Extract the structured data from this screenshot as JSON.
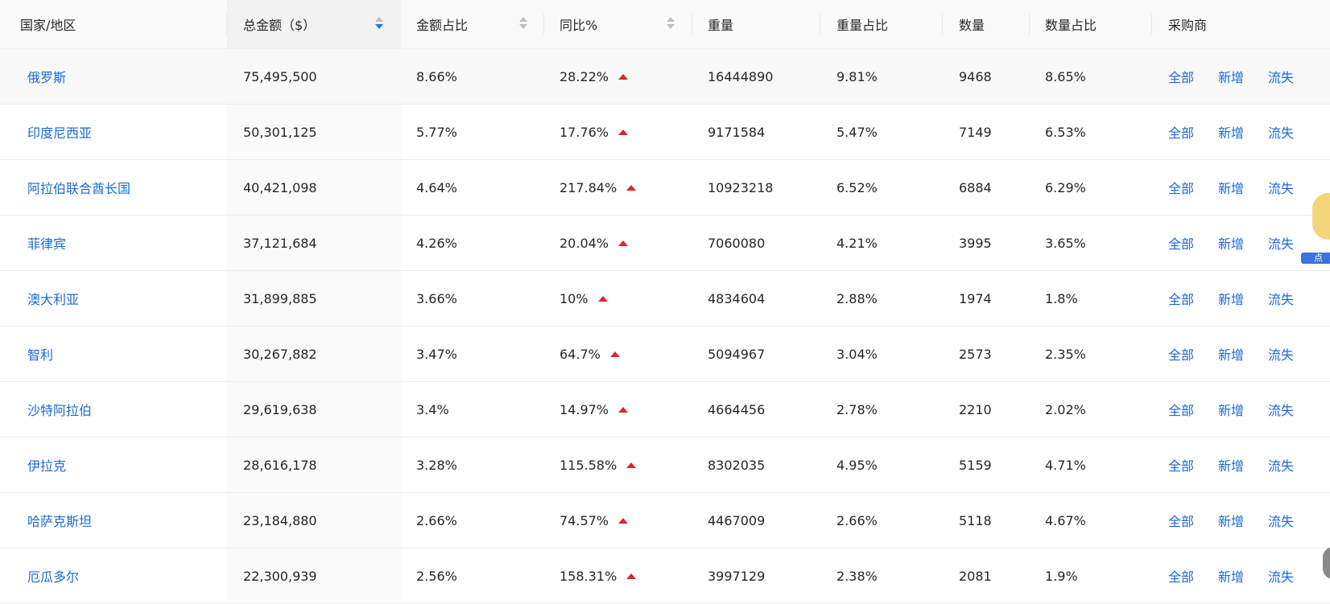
{
  "columns": {
    "country": "国家/地区",
    "total": "总金额（$）",
    "amount_share": "金额占比",
    "yoy": "同比%",
    "weight": "重量",
    "weight_share": "重量占比",
    "count": "数量",
    "count_share": "数量占比",
    "buyers": "采购商"
  },
  "sort": {
    "column": "total",
    "direction": "desc",
    "sort_indicator_color": "#1677ff"
  },
  "colors": {
    "link": "#1a6ad6",
    "up_arrow": "#e0242f"
  },
  "actions": {
    "all": "全部",
    "new": "新增",
    "lost": "流失"
  },
  "mascot_label": "点",
  "rows": [
    {
      "country": "俄罗斯",
      "total": "75,495,500",
      "amount_share": "8.66%",
      "yoy": "28.22%",
      "weight": "16444890",
      "weight_share": "9.81%",
      "count": "9468",
      "count_share": "8.65%"
    },
    {
      "country": "印度尼西亚",
      "total": "50,301,125",
      "amount_share": "5.77%",
      "yoy": "17.76%",
      "weight": "9171584",
      "weight_share": "5.47%",
      "count": "7149",
      "count_share": "6.53%"
    },
    {
      "country": "阿拉伯联合酋长国",
      "total": "40,421,098",
      "amount_share": "4.64%",
      "yoy": "217.84%",
      "weight": "10923218",
      "weight_share": "6.52%",
      "count": "6884",
      "count_share": "6.29%"
    },
    {
      "country": "菲律宾",
      "total": "37,121,684",
      "amount_share": "4.26%",
      "yoy": "20.04%",
      "weight": "7060080",
      "weight_share": "4.21%",
      "count": "3995",
      "count_share": "3.65%"
    },
    {
      "country": "澳大利亚",
      "total": "31,899,885",
      "amount_share": "3.66%",
      "yoy": "10%",
      "weight": "4834604",
      "weight_share": "2.88%",
      "count": "1974",
      "count_share": "1.8%"
    },
    {
      "country": "智利",
      "total": "30,267,882",
      "amount_share": "3.47%",
      "yoy": "64.7%",
      "weight": "5094967",
      "weight_share": "3.04%",
      "count": "2573",
      "count_share": "2.35%"
    },
    {
      "country": "沙特阿拉伯",
      "total": "29,619,638",
      "amount_share": "3.4%",
      "yoy": "14.97%",
      "weight": "4664456",
      "weight_share": "2.78%",
      "count": "2210",
      "count_share": "2.02%"
    },
    {
      "country": "伊拉克",
      "total": "28,616,178",
      "amount_share": "3.28%",
      "yoy": "115.58%",
      "weight": "8302035",
      "weight_share": "4.95%",
      "count": "5159",
      "count_share": "4.71%"
    },
    {
      "country": "哈萨克斯坦",
      "total": "23,184,880",
      "amount_share": "2.66%",
      "yoy": "74.57%",
      "weight": "4467009",
      "weight_share": "2.66%",
      "count": "5118",
      "count_share": "4.67%"
    },
    {
      "country": "厄瓜多尔",
      "total": "22,300,939",
      "amount_share": "2.56%",
      "yoy": "158.31%",
      "weight": "3997129",
      "weight_share": "2.38%",
      "count": "2081",
      "count_share": "1.9%"
    }
  ]
}
